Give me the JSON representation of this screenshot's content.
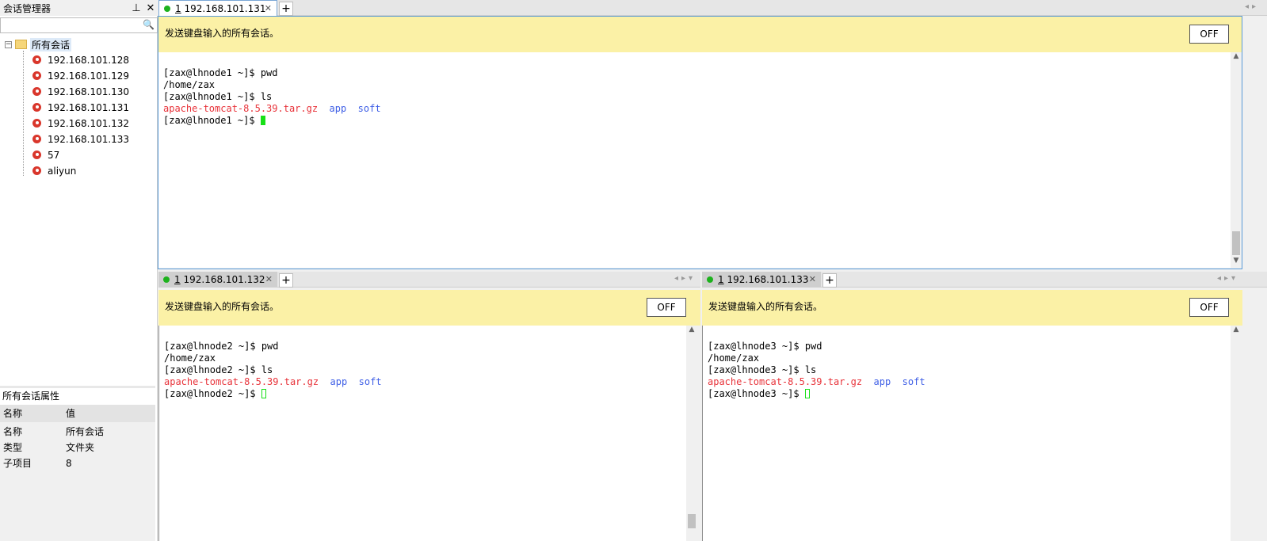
{
  "sidebar": {
    "title": "会话管理器",
    "pin_icon": "pin-icon",
    "close_icon": "close-icon",
    "search_placeholder": "",
    "root_label": "所有会话",
    "sessions": [
      {
        "label": "192.168.101.128"
      },
      {
        "label": "192.168.101.129"
      },
      {
        "label": "192.168.101.130"
      },
      {
        "label": "192.168.101.131"
      },
      {
        "label": "192.168.101.132"
      },
      {
        "label": "192.168.101.133"
      },
      {
        "label": "57"
      },
      {
        "label": "aliyun"
      }
    ]
  },
  "properties": {
    "title": "所有会话属性",
    "col_name": "名称",
    "col_value": "值",
    "rows": [
      {
        "key": "名称",
        "value": "所有会话"
      },
      {
        "key": "类型",
        "value": "文件夹"
      },
      {
        "key": "子项目",
        "value": "8"
      }
    ]
  },
  "panes": [
    {
      "tab_index": "1",
      "tab_label": "192.168.101.131",
      "banner": "发送键盘输入的所有会话。",
      "off_label": "OFF",
      "lines": [
        {
          "text": "[zax@lhnode1 ~]$ pwd"
        },
        {
          "text": "/home/zax"
        },
        {
          "text": "[zax@lhnode1 ~]$ ls"
        },
        {
          "red": "apache-tomcat-8.5.39.tar.gz",
          "blue1": "app",
          "blue2": "soft"
        },
        {
          "text": "[zax@lhnode1 ~]$ "
        }
      ]
    },
    {
      "tab_index": "1",
      "tab_label": "192.168.101.132",
      "banner": "发送键盘输入的所有会话。",
      "off_label": "OFF",
      "lines": [
        {
          "text": "[zax@lhnode2 ~]$ pwd"
        },
        {
          "text": "/home/zax"
        },
        {
          "text": "[zax@lhnode2 ~]$ ls"
        },
        {
          "red": "apache-tomcat-8.5.39.tar.gz",
          "blue1": "app",
          "blue2": "soft"
        },
        {
          "text": "[zax@lhnode2 ~]$ "
        }
      ]
    },
    {
      "tab_index": "1",
      "tab_label": "192.168.101.133",
      "banner": "发送键盘输入的所有会话。",
      "off_label": "OFF",
      "lines": [
        {
          "text": "[zax@lhnode3 ~]$ pwd"
        },
        {
          "text": "/home/zax"
        },
        {
          "text": "[zax@lhnode3 ~]$ ls"
        },
        {
          "red": "apache-tomcat-8.5.39.tar.gz",
          "blue1": "app",
          "blue2": "soft"
        },
        {
          "text": "[zax@lhnode3 ~]$ "
        }
      ]
    }
  ],
  "new_tab_label": "+"
}
